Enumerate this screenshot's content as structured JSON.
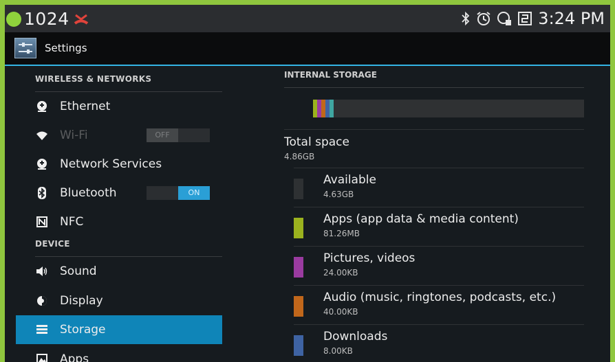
{
  "status_bar": {
    "left_text": "1024",
    "time": "3:24 PM",
    "icons": [
      "bluetooth-icon",
      "alarm-icon",
      "data-icon",
      "sync-icon"
    ]
  },
  "action_bar": {
    "title": "Settings"
  },
  "sidebar": {
    "sections": [
      {
        "header": "WIRELESS & NETWORKS",
        "items": [
          {
            "label": "Ethernet",
            "icon": "ethernet-icon"
          },
          {
            "label": "Wi-Fi",
            "icon": "wifi-icon",
            "toggle": "OFF",
            "disabled": true
          },
          {
            "label": "Network Services",
            "icon": "network-icon"
          },
          {
            "label": "Bluetooth",
            "icon": "bluetooth-icon",
            "toggle": "ON"
          },
          {
            "label": "NFC",
            "icon": "nfc-icon"
          }
        ]
      },
      {
        "header": "DEVICE",
        "items": [
          {
            "label": "Sound",
            "icon": "sound-icon"
          },
          {
            "label": "Display",
            "icon": "display-icon"
          },
          {
            "label": "Storage",
            "icon": "storage-icon",
            "selected": true
          },
          {
            "label": "Apps",
            "icon": "apps-icon"
          }
        ]
      }
    ]
  },
  "storage": {
    "header": "INTERNAL STORAGE",
    "total_label": "Total space",
    "total_value": "4.86GB",
    "entries": [
      {
        "label": "Available",
        "value": "4.63GB",
        "color": "#2e3133"
      },
      {
        "label": "Apps (app data & media content)",
        "value": "81.26MB",
        "color": "#9bb21e"
      },
      {
        "label": "Pictures, videos",
        "value": "24.00KB",
        "color": "#9a3ba0"
      },
      {
        "label": "Audio (music, ringtones, podcasts, etc.)",
        "value": "40.00KB",
        "color": "#c1671b"
      },
      {
        "label": "Downloads",
        "value": "8.00KB",
        "color": "#3e63a3"
      }
    ]
  },
  "colors": {
    "accent": "#33b5e5",
    "selected": "#0f85b8",
    "frame": "#8fc63e"
  }
}
